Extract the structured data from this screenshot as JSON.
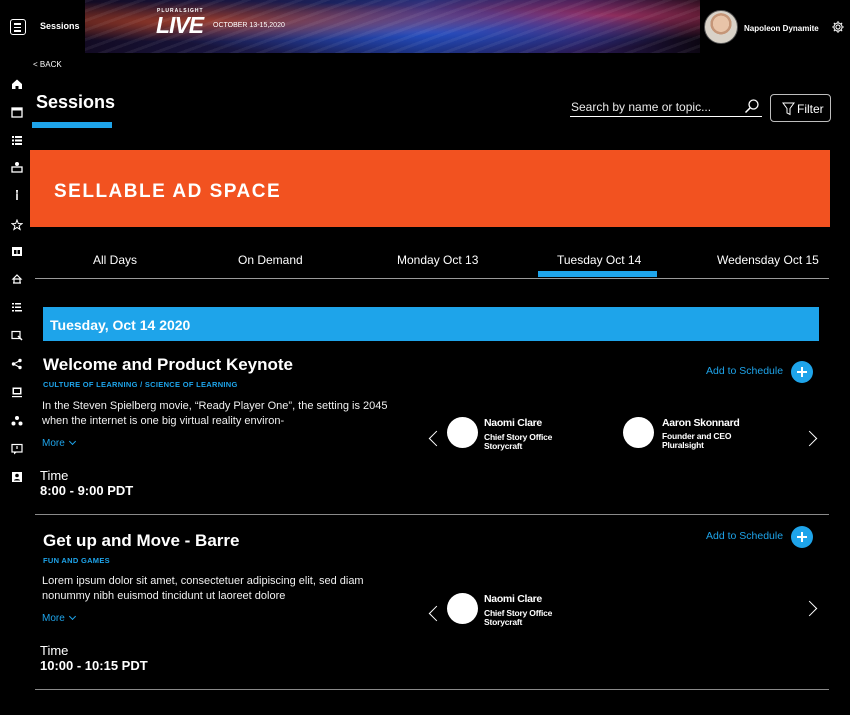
{
  "header": {
    "section_title": "Sessions",
    "brand": "PLURALSIGHT",
    "logo": "LIVE",
    "event_dates": "OCTOBER 13-15,2020",
    "user_name": "Napoleon Dynamite",
    "icons": [
      "menu-icon",
      "gear-icon"
    ]
  },
  "nav_icons": [
    "home-icon",
    "calendar-icon",
    "list-icon",
    "presenter-icon",
    "torch-icon",
    "star-icon",
    "calendar-plus-icon",
    "expo-icon",
    "ordered-list-icon",
    "feedback-icon",
    "share-icon",
    "monitor-icon",
    "network-icon",
    "chat-icon",
    "contact-icon"
  ],
  "back_label": "< BACK",
  "page_title": "Sessions",
  "search": {
    "placeholder": "Search by name or topic..."
  },
  "filter_label": "Filter",
  "ad_text": "SELLABLE AD SPACE",
  "tabs": [
    {
      "label": "All Days"
    },
    {
      "label": "On Demand"
    },
    {
      "label": "Monday Oct 13"
    },
    {
      "label": "Tuesday Oct 14",
      "active": true
    },
    {
      "label": "Wedensday Oct 15"
    }
  ],
  "day_header": "Tuesday, Oct 14 2020",
  "sessions": [
    {
      "title": "Welcome and Product Keynote",
      "category": "CULTURE OF LEARNING / SCIENCE OF LEARNING",
      "description": "In the Steven Spielberg movie, “Ready Player One”, the setting is 2045 when the internet is one big virtual reality environ-",
      "more_label": "More",
      "time_label": "Time",
      "time": "8:00 - 9:00 PDT",
      "add_label": "Add to Schedule",
      "speakers": [
        {
          "name": "Naomi Clare",
          "role": "Chief Story Office",
          "org": "Storycraft"
        },
        {
          "name": "Aaron Skonnard",
          "role": "Founder and CEO",
          "org": "Pluralsight"
        }
      ]
    },
    {
      "title": "Get up and Move - Barre",
      "category": "FUN AND GAMES",
      "description": "Lorem ipsum dolor sit amet, consectetuer adipiscing elit, sed diam nonummy nibh euismod tincidunt ut laoreet dolore",
      "more_label": "More",
      "time_label": "Time",
      "time": "10:00 - 10:15 PDT",
      "add_label": "Add to Schedule",
      "speakers": [
        {
          "name": "Naomi Clare",
          "role": "Chief Story Office",
          "org": "Storycraft"
        }
      ]
    }
  ],
  "colors": {
    "accent": "#1ea4ea",
    "ad": "#f25220",
    "background": "#000000"
  }
}
